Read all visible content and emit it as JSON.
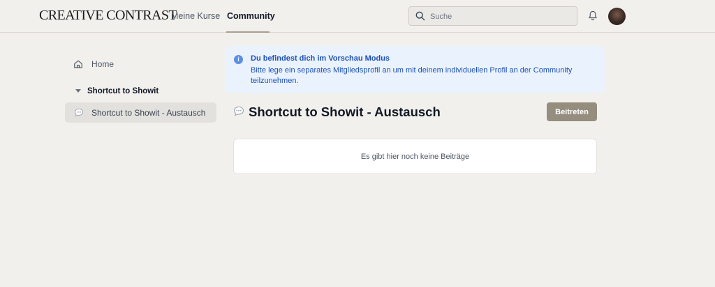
{
  "header": {
    "logo": "CREATIVE CONTRAST",
    "nav": [
      "Meine Kurse",
      "Community"
    ],
    "active_nav": "Community",
    "search_placeholder": "Suche"
  },
  "sidebar": {
    "home_label": "Home",
    "group_label": "Shortcut to Showit",
    "space_label": "Shortcut to Showit - Austausch"
  },
  "notice": {
    "title": "Du befindest dich im Vorschau Modus",
    "body": "Bitte lege ein separates Mitgliedsprofil an um mit deinem individuellen Profil an der Community teilzunehmen."
  },
  "space": {
    "title": "Shortcut to Showit - Austausch",
    "join_label": "Beitreten",
    "empty_message": "Es gibt hier noch keine Beiträge"
  },
  "colors": {
    "background": "#f2f0ec",
    "accent_button": "#958d7e",
    "notice_bg": "#eaf3fd",
    "notice_text": "#1d4fb8",
    "info_icon": "#5b8ee6"
  },
  "icons": [
    "search-icon",
    "bell-icon",
    "home-icon",
    "triangle-down-icon",
    "chat-bubble-icon",
    "info-icon"
  ]
}
